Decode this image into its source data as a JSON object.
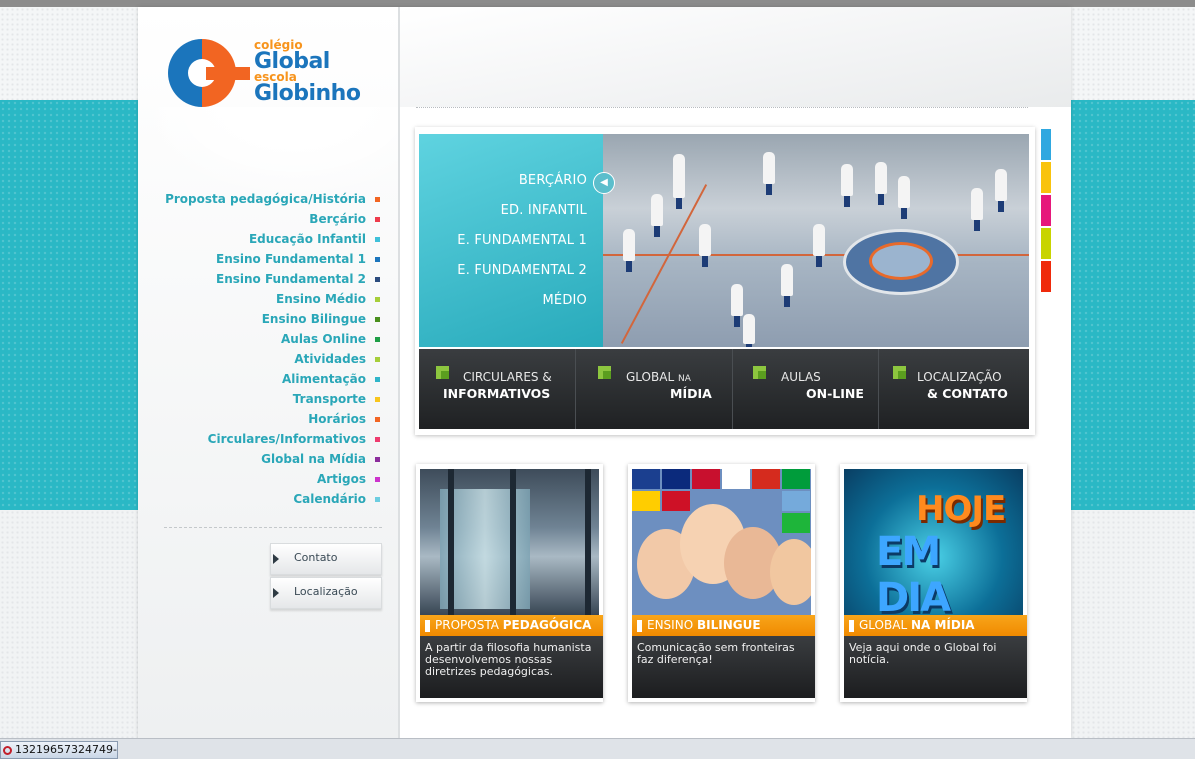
{
  "logo": {
    "line1": "colégio",
    "line2": "Global",
    "line3": "escola",
    "line4": "Globinho"
  },
  "sidebar": {
    "items": [
      {
        "label": "Proposta pedagógica/História",
        "color": "#f26522"
      },
      {
        "label": "Berçário",
        "color": "#ee3b4b"
      },
      {
        "label": "Educação Infantil",
        "color": "#3fc0d9"
      },
      {
        "label": "Ensino Fundamental 1",
        "color": "#1b75bc"
      },
      {
        "label": "Ensino Fundamental 2",
        "color": "#2b4c7e"
      },
      {
        "label": "Ensino Médio",
        "color": "#a6ce39"
      },
      {
        "label": "Ensino Bilingue",
        "color": "#4a8f1d"
      },
      {
        "label": "Aulas Online",
        "color": "#1e9e46"
      },
      {
        "label": "Atividades",
        "color": "#a6ce39"
      },
      {
        "label": "Alimentação",
        "color": "#2fb5c9"
      },
      {
        "label": "Transporte",
        "color": "#f8c51c"
      },
      {
        "label": "Horários",
        "color": "#f26522"
      },
      {
        "label": "Circulares/Informativos",
        "color": "#ee3b6e"
      },
      {
        "label": "Global na Mídia",
        "color": "#8c2d9c"
      },
      {
        "label": "Artigos",
        "color": "#cc33cc"
      },
      {
        "label": "Calendário",
        "color": "#6ccde0"
      }
    ],
    "buttons": {
      "contact": "Contato",
      "location": "Localização"
    }
  },
  "banner": {
    "levels": [
      "BERÇÁRIO",
      "ED. INFANTIL",
      "E. FUNDAMENTAL  1",
      "E. FUNDAMENTAL 2",
      "MÉDIO"
    ]
  },
  "quick_links": [
    {
      "top": "CIRCULARES &",
      "bottom": "INFORMATIVOS"
    },
    {
      "top": "GLOBAL",
      "top_small": "NA",
      "bottom": "MÍDIA"
    },
    {
      "top": "AULAS",
      "bottom": "ON-LINE"
    },
    {
      "top": "LOCALIZAÇÃO",
      "bottom": "& CONTATO"
    }
  ],
  "side_tabs_colors": [
    "#2fa8e0",
    "#f9c30d",
    "#e6187b",
    "#c8d400",
    "#ef2a0b"
  ],
  "cards": [
    {
      "title_light": "PROPOSTA",
      "title_bold": "PEDAGÓGICA",
      "desc": "A partir da filosofia humanista desenvolvemos nossas diretrizes pedagógicas."
    },
    {
      "title_light": "ENSINO",
      "title_bold": "BILINGUE",
      "desc": "Comunicação sem fronteiras faz diferença!"
    },
    {
      "title_light": "GLOBAL",
      "title_bold": "NA MÍDIA",
      "desc": "Veja aqui onde o Global foi notícia."
    }
  ],
  "hoje": {
    "line1": "HOJE",
    "line2": "EM DIA"
  },
  "statusbar": {
    "task": "13219657324749-..."
  }
}
